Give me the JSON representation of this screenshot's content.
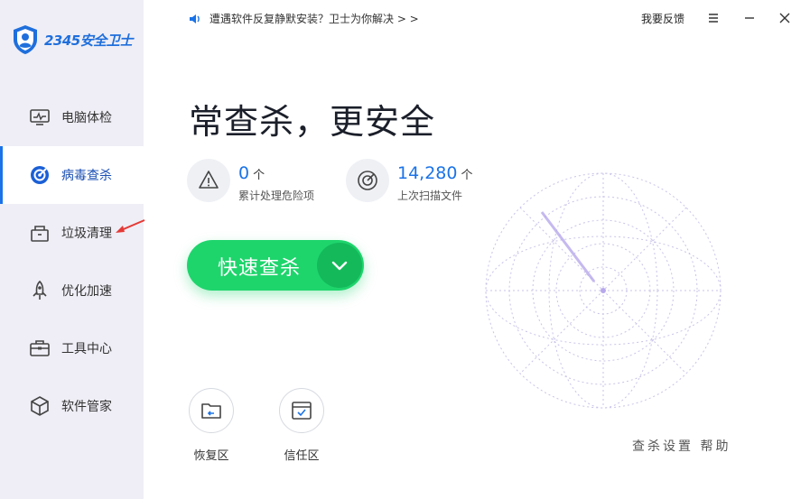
{
  "app": {
    "logo_text": "2345安全卫士"
  },
  "sidebar": {
    "items": [
      {
        "label": "电脑体检"
      },
      {
        "label": "病毒查杀"
      },
      {
        "label": "垃圾清理"
      },
      {
        "label": "优化加速"
      },
      {
        "label": "工具中心"
      },
      {
        "label": "软件管家"
      }
    ]
  },
  "topbar": {
    "notice": "遭遇软件反复静默安装？卫士为你解决 > >",
    "feedback": "我要反馈"
  },
  "main": {
    "headline": "常查杀，更安全",
    "stats": [
      {
        "value": "0",
        "unit": "个",
        "caption": "累计处理危险项"
      },
      {
        "value": "14,280",
        "unit": "个",
        "caption": "上次扫描文件"
      }
    ],
    "scan_button": "快速查杀",
    "tools": [
      {
        "label": "恢复区"
      },
      {
        "label": "信任区"
      }
    ],
    "corner_text": "查杀设置  帮助"
  },
  "colors": {
    "accent": "#1a73e8",
    "scan_green": "#1ed56c",
    "sidebar_bg": "#efeef6"
  }
}
